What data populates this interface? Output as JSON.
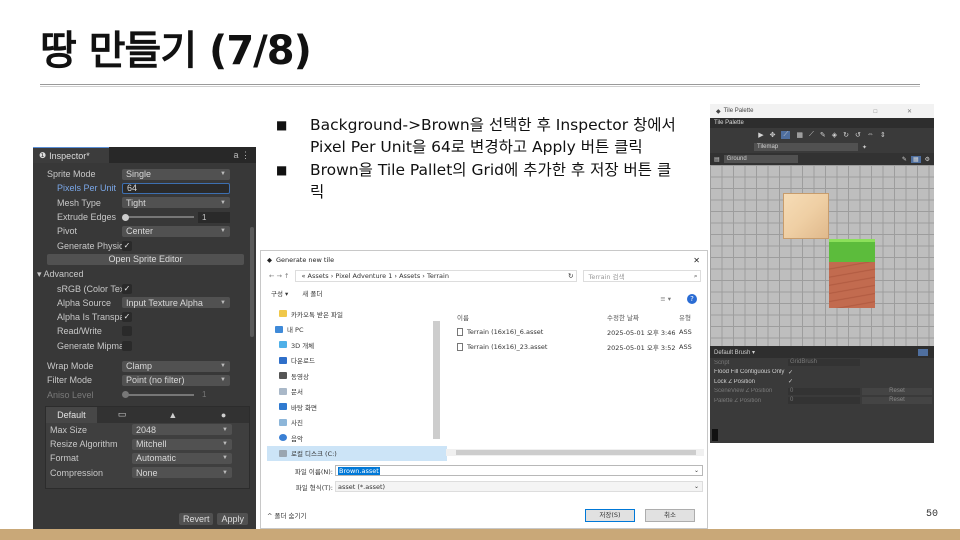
{
  "slide": {
    "title": "땅 만들기 (7/8)",
    "page_number": "50",
    "bullets": [
      "Background->Brown을 선택한 후 Inspector 창에서 Pixel Per Unit을 64로 변경하고 Apply 버튼 클릭",
      "Brown을 Tile Pallet의 Grid에 추가한 후 저장 버튼 클릭"
    ],
    "bullet_mark": "■"
  },
  "inspector": {
    "tab": "Inspector*",
    "tab_icon": "info-icon",
    "header_icons": "a ⋮",
    "sprite_mode_label": "Sprite Mode",
    "sprite_mode": "Single",
    "ppu_label": "Pixels Per Unit",
    "ppu": "64",
    "mesh_type_label": "Mesh Type",
    "mesh_type": "Tight",
    "extrude_label": "Extrude Edges",
    "extrude": "1",
    "pivot_label": "Pivot",
    "pivot": "Center",
    "gen_physics_label": "Generate Physics",
    "open_sprite_editor": "Open Sprite Editor",
    "advanced": "Advanced",
    "srgb_label": "sRGB (Color Textu",
    "alpha_source_label": "Alpha Source",
    "alpha_source": "Input Texture Alpha",
    "alpha_transparent_label": "Alpha Is Transpare",
    "read_write_label": "Read/Write",
    "gen_mipmap_label": "Generate Mipmap",
    "wrap_mode_label": "Wrap Mode",
    "wrap_mode": "Clamp",
    "filter_mode_label": "Filter Mode",
    "filter_mode": "Point (no filter)",
    "aniso_label": "Aniso Level",
    "aniso": "1",
    "platform_tab_default": "Default",
    "platform_icons": [
      "monitor-icon",
      "android-icon",
      "apple-icon"
    ],
    "max_size_label": "Max Size",
    "max_size": "2048",
    "resize_label": "Resize Algorithm",
    "resize": "Mitchell",
    "format_label": "Format",
    "format": "Automatic",
    "compression_label": "Compression",
    "compression": "None",
    "revert": "Revert",
    "apply": "Apply",
    "check_glyph": "✓"
  },
  "dialog": {
    "title": "Generate new tile",
    "close": "✕",
    "nav_buttons": "←  →  ↑",
    "address": "« Assets  ›  Pixel Adventure 1  ›  Assets  ›  Terrain",
    "refresh": "↻",
    "search_placeholder": "Terrain 검색",
    "organize": "구성 ▾",
    "new_folder": "새 폴더",
    "help": "?",
    "view_icon": "≡ ▾",
    "nav_items": [
      "카카오톡 받은 파일",
      "내 PC",
      "3D 개체",
      "다운로드",
      "동영상",
      "문서",
      "바탕 화면",
      "사진",
      "음악",
      "로컬 디스크 (C:)"
    ],
    "col_name": "이름",
    "col_date": "수정한 날짜",
    "col_type": "유형",
    "files": [
      {
        "name": "Terrain (16x16)_6.asset",
        "date": "2025-05-01 오후 3:46",
        "type": "ASS"
      },
      {
        "name": "Terrain (16x16)_23.asset",
        "date": "2025-05-01 오후 3:52",
        "type": "ASS"
      }
    ],
    "filename_label": "파일 이름(N):",
    "filename": "Brown.asset",
    "filetype_label": "파일 형식(T):",
    "filetype": "asset (*.asset)",
    "hide_folders": "^ 폴더 숨기기",
    "save": "저장(S)",
    "cancel": "취소"
  },
  "palette": {
    "window_title": "Tile Palette",
    "window_controls": "□ ✕",
    "tab": "Tile Palette",
    "tools": [
      "▶",
      "✥",
      "⟋",
      "▦",
      "⟋",
      "✎",
      "◈",
      "↻",
      "↺",
      "⇔",
      "⇕"
    ],
    "tilemap": "Tilemap",
    "palette_name": "Ground",
    "brush": "Default Brush",
    "props": [
      {
        "label": "Script",
        "value": "GridBrush",
        "dim": true
      },
      {
        "label": "Flood Fill Contiguous Only",
        "value": "✓",
        "dim": false
      },
      {
        "label": "Lock Z Position",
        "value": "✓",
        "dim": false
      },
      {
        "label": "SceneView Z Position",
        "value": "0",
        "dim": true,
        "reset": "Reset"
      },
      {
        "label": "Palette Z Position",
        "value": "0",
        "dim": true,
        "reset": "Reset"
      }
    ],
    "colors": {
      "brown_light": "#efcfa4",
      "brown_dark": "#c58c60",
      "grass": "#5cbc3c",
      "dirt": "#c26b4f"
    }
  }
}
